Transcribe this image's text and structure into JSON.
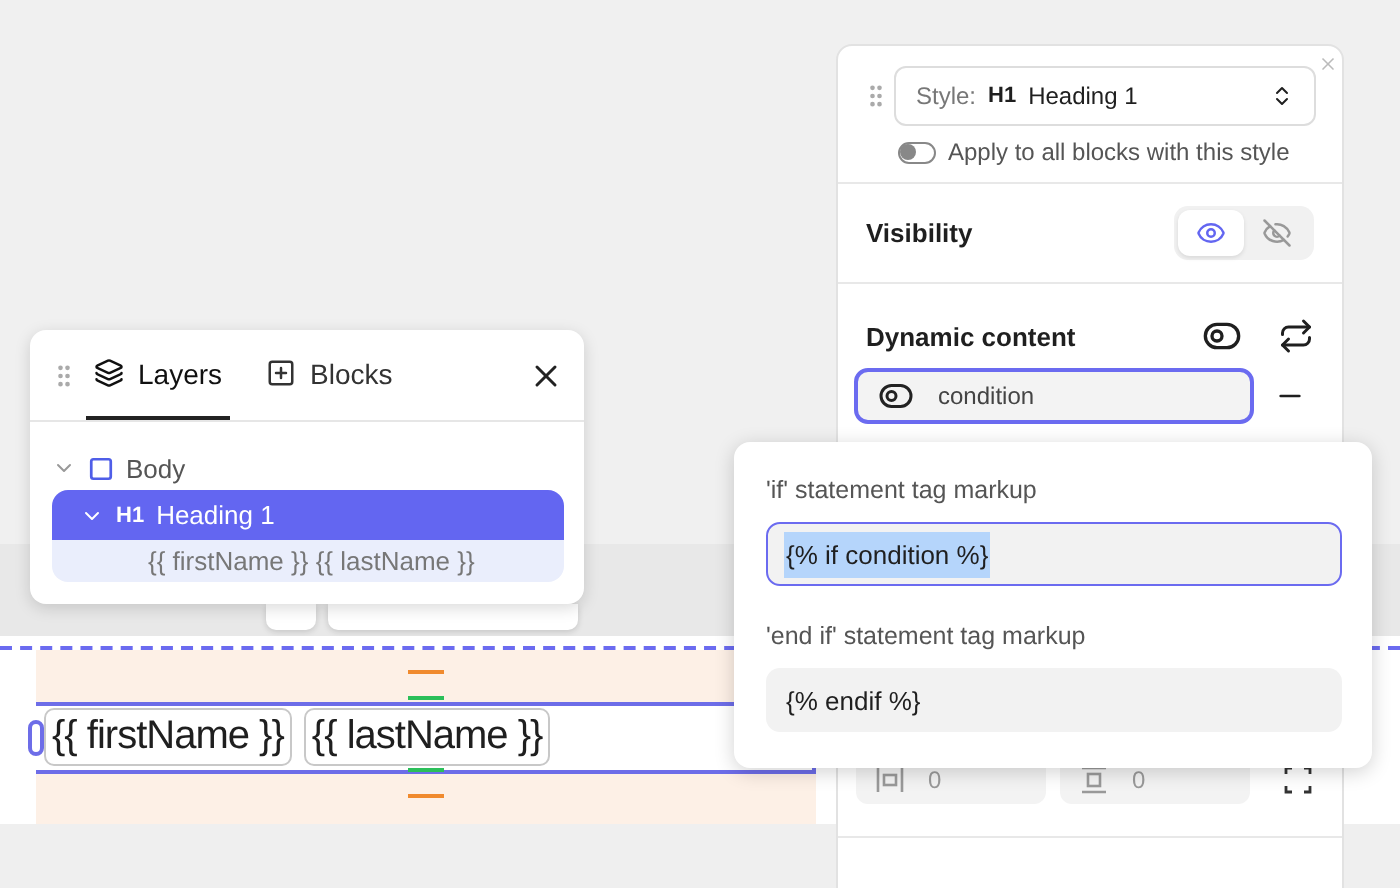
{
  "layers_panel": {
    "tabs": [
      {
        "kind": "layers",
        "label": "Layers",
        "selected": true
      },
      {
        "kind": "blocks",
        "label": "Blocks",
        "selected": false
      }
    ],
    "tree": [
      {
        "kind": "body",
        "label": "Body",
        "expanded": true,
        "selected": false,
        "children": [
          {
            "kind": "heading",
            "tag": "H1",
            "label": "Heading 1",
            "expanded": true,
            "selected": true,
            "children": [
              {
                "kind": "text",
                "label": "{{ firstName }} {{ lastName }}",
                "selected": false
              }
            ]
          }
        ]
      }
    ]
  },
  "canvas": {
    "heading_chips": [
      "{{ firstName }}",
      "{{ lastName }}"
    ]
  },
  "style_panel": {
    "style_select": {
      "label": "Style:",
      "tag": "H1",
      "value": "Heading 1"
    },
    "apply_toggle": {
      "label": "Apply to all blocks with this style",
      "on": false
    },
    "visibility": {
      "label": "Visibility",
      "options": [
        {
          "kind": "visible",
          "selected": true
        },
        {
          "kind": "hidden",
          "selected": false
        }
      ]
    },
    "dynamic_content": {
      "label": "Dynamic content",
      "condition": "condition"
    },
    "spacing": [
      {
        "kind": "horizontal",
        "placeholder": "0"
      },
      {
        "kind": "vertical",
        "placeholder": "0"
      }
    ]
  },
  "condition_popup": {
    "fields": [
      {
        "label": "'if' statement tag markup",
        "value": "{% if condition %}",
        "focused": true
      },
      {
        "label": "'end if' statement tag markup",
        "value": "{% endif %}",
        "focused": false
      }
    ]
  }
}
